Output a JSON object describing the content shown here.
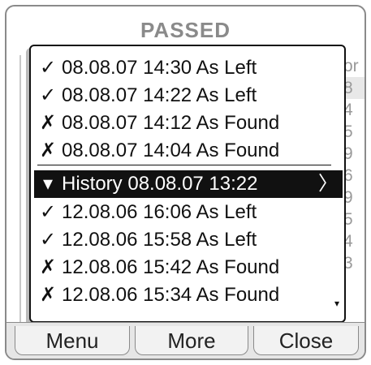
{
  "title": "PASSED",
  "background_column": [
    "or",
    "8",
    "4",
    "5",
    "9",
    "6",
    "9",
    "5",
    "4",
    "3"
  ],
  "history_list": [
    {
      "icon": "✓",
      "icon_name": "check-icon",
      "text": "08.08.07 14:30 As Left"
    },
    {
      "icon": "✗",
      "icon_name": "cross-icon",
      "text": "08.08.07 14:22 As Left",
      "icon_actual": "✓"
    },
    {
      "icon": "✗",
      "icon_name": "cross-icon",
      "text": "08.08.07 14:12 As Found"
    },
    {
      "icon": "✗",
      "icon_name": "cross-icon",
      "text": "08.08.07 14:04 As Found"
    },
    {
      "icon": "▾",
      "icon_name": "history-collapse-icon",
      "text": "History 08.08.07 13:22",
      "arrow": "〉"
    },
    {
      "icon": "✓",
      "icon_name": "check-icon",
      "text": "12.08.06 16:06 As Left"
    },
    {
      "icon": "✓",
      "icon_name": "check-icon",
      "text": "12.08.06 15:58 As Left"
    },
    {
      "icon": "✗",
      "icon_name": "cross-icon",
      "text": "12.08.06 15:42 As Found"
    },
    {
      "icon": "✗",
      "icon_name": "cross-icon",
      "text": "12.08.06 15:34 As Found",
      "more": "▾"
    }
  ],
  "softkeys": {
    "menu": "Menu",
    "more": "More",
    "close": "Close"
  }
}
